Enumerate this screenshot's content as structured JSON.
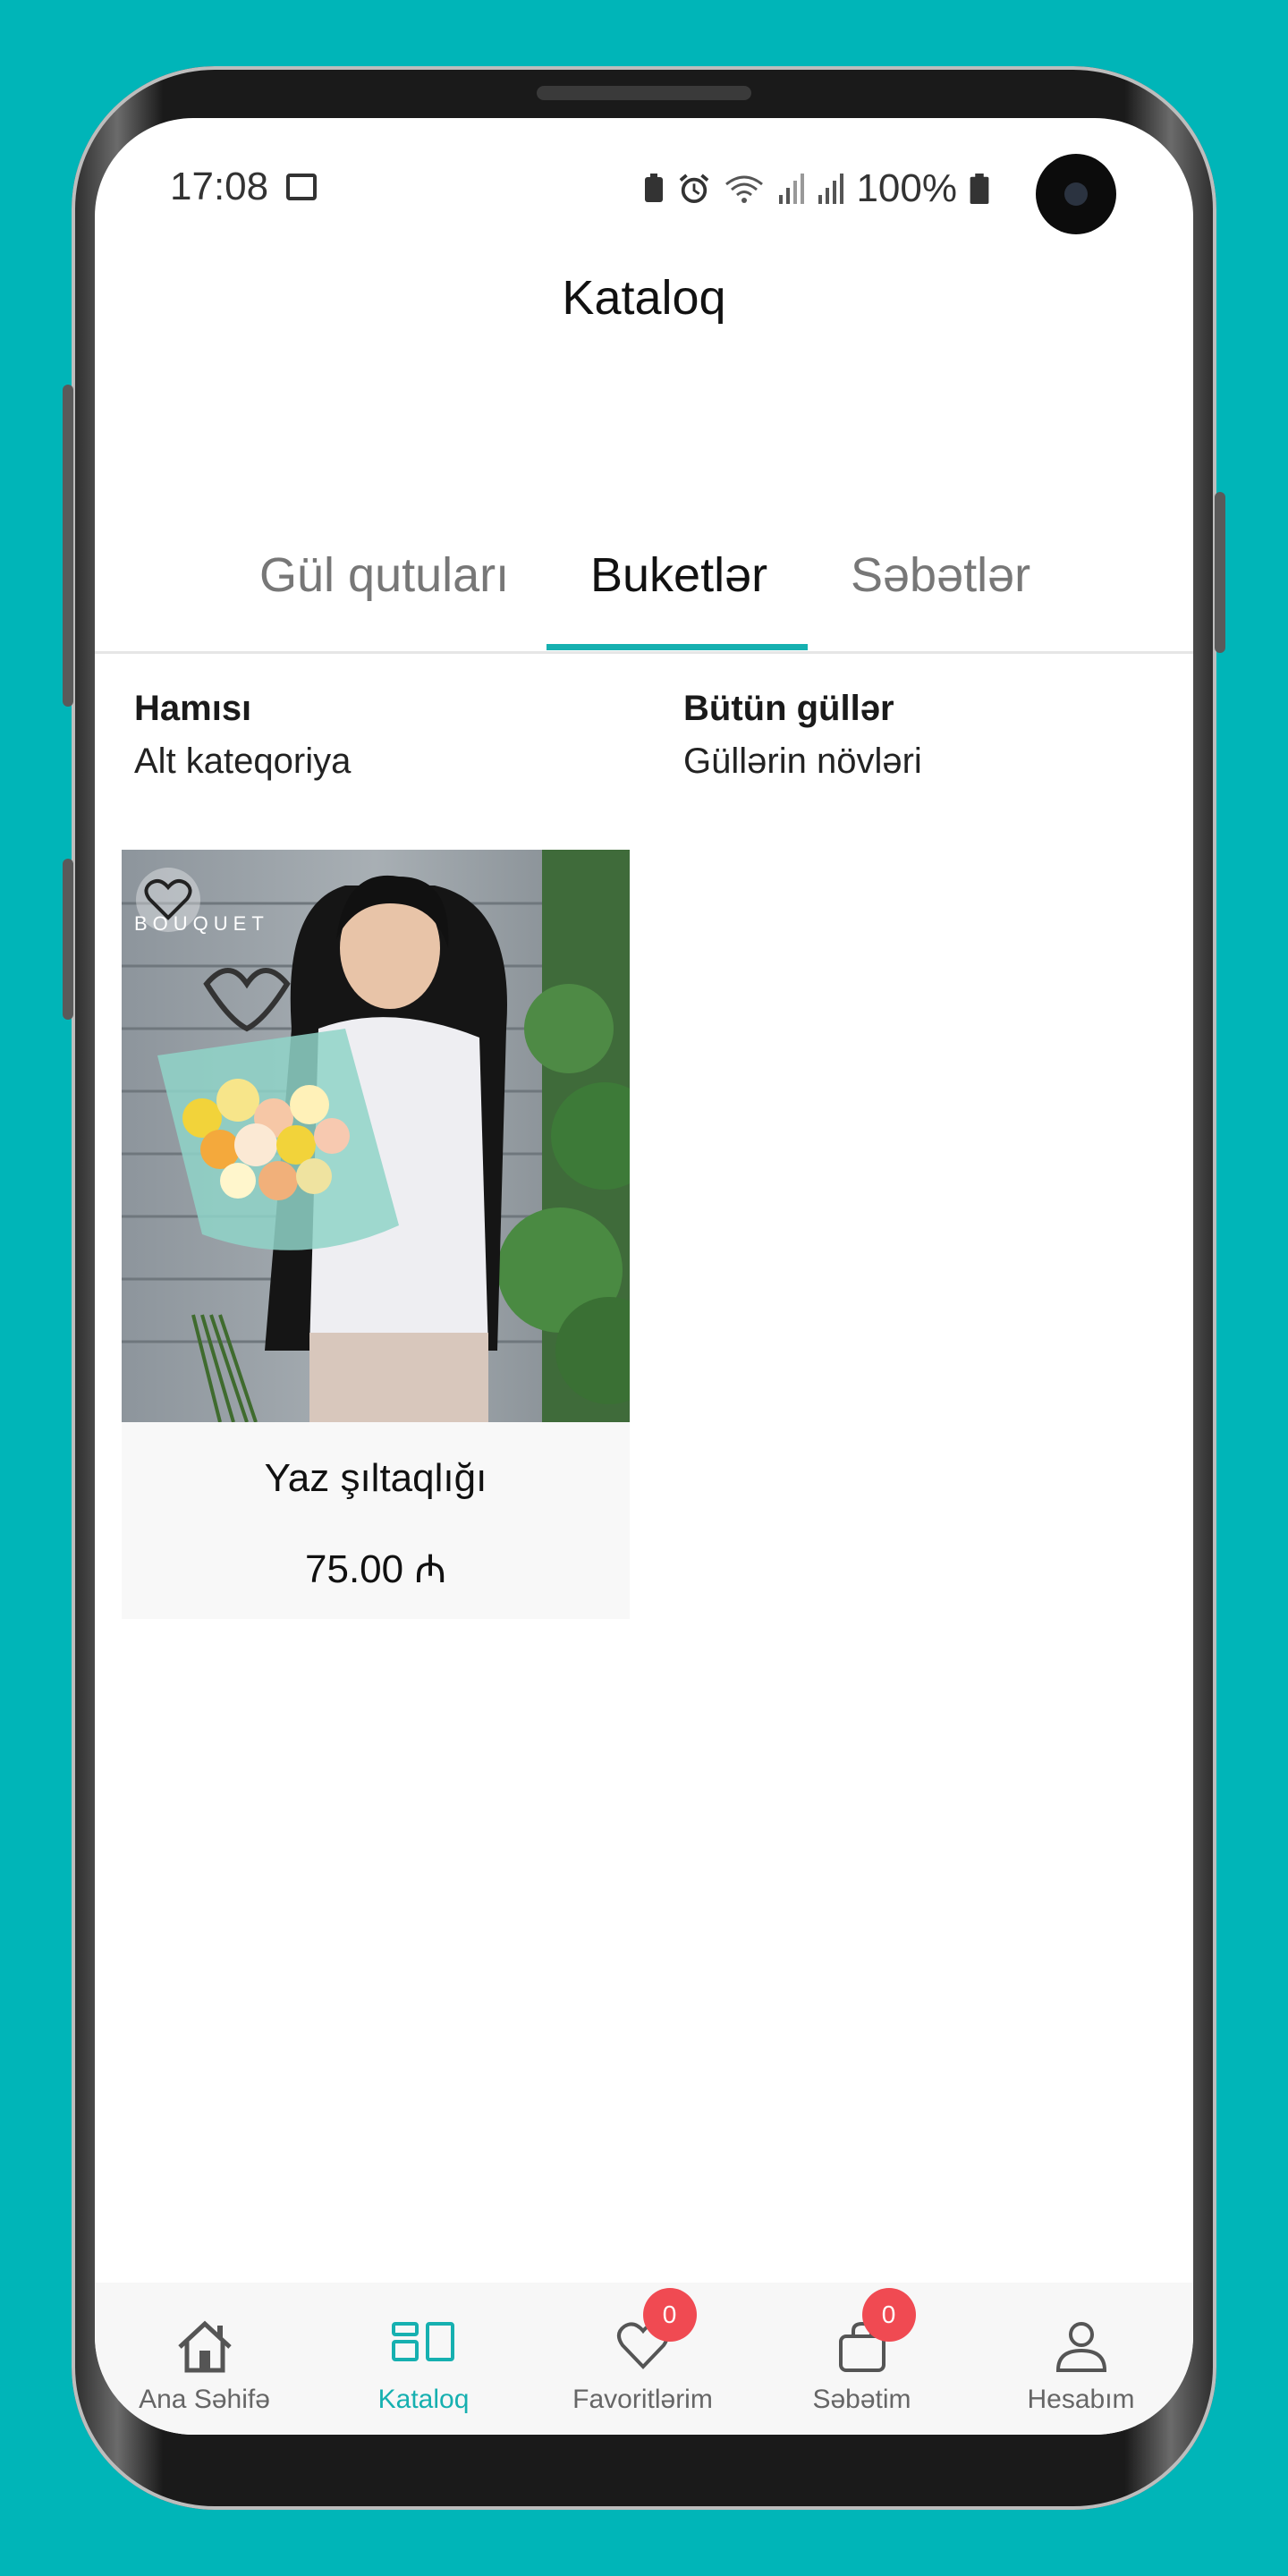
{
  "status_bar": {
    "time": "17:08",
    "battery": "100%"
  },
  "header": {
    "title": "Kataloq"
  },
  "tabs": [
    {
      "label": "Gül qutuları",
      "active": false
    },
    {
      "label": "Buketlər",
      "active": true
    },
    {
      "label": "Səbətlər",
      "active": false
    }
  ],
  "filters": {
    "subcategory": {
      "title": "Hamısı",
      "subtitle": "Alt kateqoriya"
    },
    "rose_type": {
      "title": "Bütün güllər",
      "subtitle": "Güllərin növləri"
    }
  },
  "products": [
    {
      "name": "Yaz şıltaqlığı",
      "price": "75.00 ₼",
      "brand_watermark": "BOUQUET"
    }
  ],
  "bottom_nav": [
    {
      "label": "Ana Səhifə",
      "icon": "home-icon",
      "active": false
    },
    {
      "label": "Kataloq",
      "icon": "catalog-icon",
      "active": true
    },
    {
      "label": "Favoritlərim",
      "icon": "heart-icon",
      "active": false,
      "badge": "0"
    },
    {
      "label": "Səbətim",
      "icon": "bag-icon",
      "active": false,
      "badge": "0"
    },
    {
      "label": "Hesabım",
      "icon": "user-icon",
      "active": false
    }
  ],
  "colors": {
    "background": "#00B5B8",
    "accent": "#16B0B0",
    "badge": "#F04A52"
  }
}
